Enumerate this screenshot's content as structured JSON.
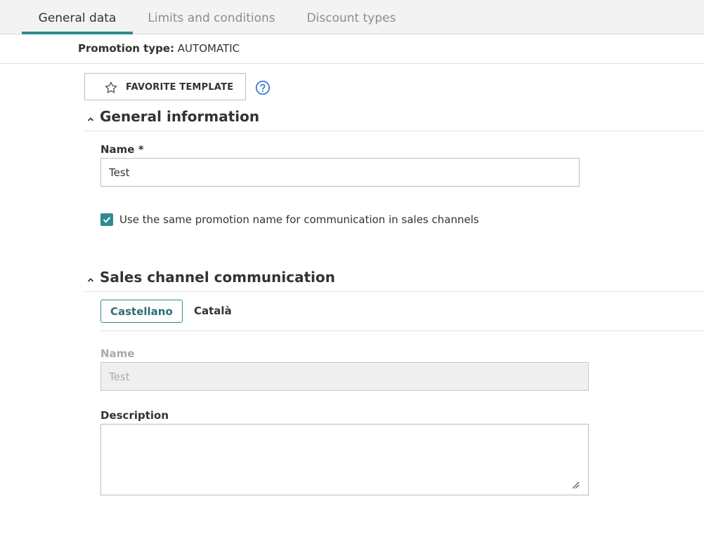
{
  "tabs": [
    {
      "label": "General data",
      "active": true
    },
    {
      "label": "Limits and conditions",
      "active": false
    },
    {
      "label": "Discount types",
      "active": false
    }
  ],
  "promotion": {
    "type_label": "Promotion type:",
    "type_value": "AUTOMATIC"
  },
  "favorite_button": {
    "label": "FAVORITE TEMPLATE",
    "icon": "star-icon"
  },
  "help_icon": "help-circle-icon",
  "general_information": {
    "title": "General information",
    "name_label": "Name *",
    "name_value": "Test",
    "same_name_checkbox": {
      "checked": true,
      "label": "Use the same promotion name for communication in sales channels"
    }
  },
  "sales_channel": {
    "title": "Sales channel communication",
    "languages": [
      {
        "label": "Castellano",
        "active": true
      },
      {
        "label": "Català",
        "active": false
      }
    ],
    "name_label": "Name",
    "name_value": "Test",
    "description_label": "Description",
    "description_value": ""
  },
  "colors": {
    "accent": "#2e8c8f",
    "help_icon": "#2f74d0"
  }
}
